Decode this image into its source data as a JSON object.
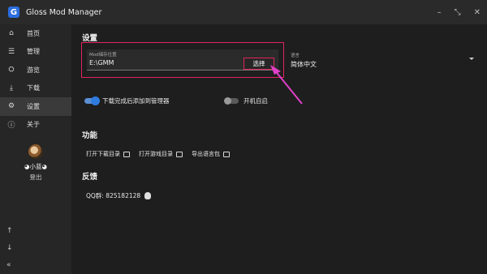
{
  "titlebar": {
    "logo_letter": "G",
    "title": "Gloss Mod Manager",
    "minimize": "–",
    "restore": "⤡",
    "close": "✕"
  },
  "sidebar": {
    "items": [
      {
        "label": "首页",
        "icon": "home-icon",
        "glyph": "⌂"
      },
      {
        "label": "管理",
        "icon": "list-icon",
        "glyph": "☰"
      },
      {
        "label": "游览",
        "icon": "gamepad-icon",
        "glyph": "⛭"
      },
      {
        "label": "下载",
        "icon": "download-icon",
        "glyph": "⤓"
      },
      {
        "label": "设置",
        "icon": "gear-icon",
        "glyph": "⚙"
      },
      {
        "label": "关于",
        "icon": "info-icon",
        "glyph": "ⓘ"
      }
    ],
    "active_index": 4,
    "user": {
      "name": "◕小蓝◕",
      "login": "登出"
    },
    "bottom": {
      "up": "↑",
      "down": "↓",
      "collapse": "«"
    }
  },
  "settings": {
    "title": "设置",
    "cache_path": {
      "label": "Mod储存位置",
      "value": "E:\\GMM",
      "button": "选择"
    },
    "language": {
      "label": "语言",
      "value": "简体中文"
    },
    "toggles": [
      {
        "label": "下载完成后添加到管理器",
        "on": true
      },
      {
        "label": "开机自启",
        "on": false
      }
    ]
  },
  "functions": {
    "title": "功能",
    "buttons": [
      {
        "label": "打开下载目录",
        "icon": "folder-icon"
      },
      {
        "label": "打开游戏目录",
        "icon": "folder-icon"
      },
      {
        "label": "导出语言包",
        "icon": "export-icon"
      }
    ]
  },
  "feedback": {
    "title": "反馈",
    "qq": "QQ群: 825182128"
  },
  "colors": {
    "highlight": "#e0245e",
    "accent": "#2f7ce0",
    "background": "#1e1e1e"
  }
}
